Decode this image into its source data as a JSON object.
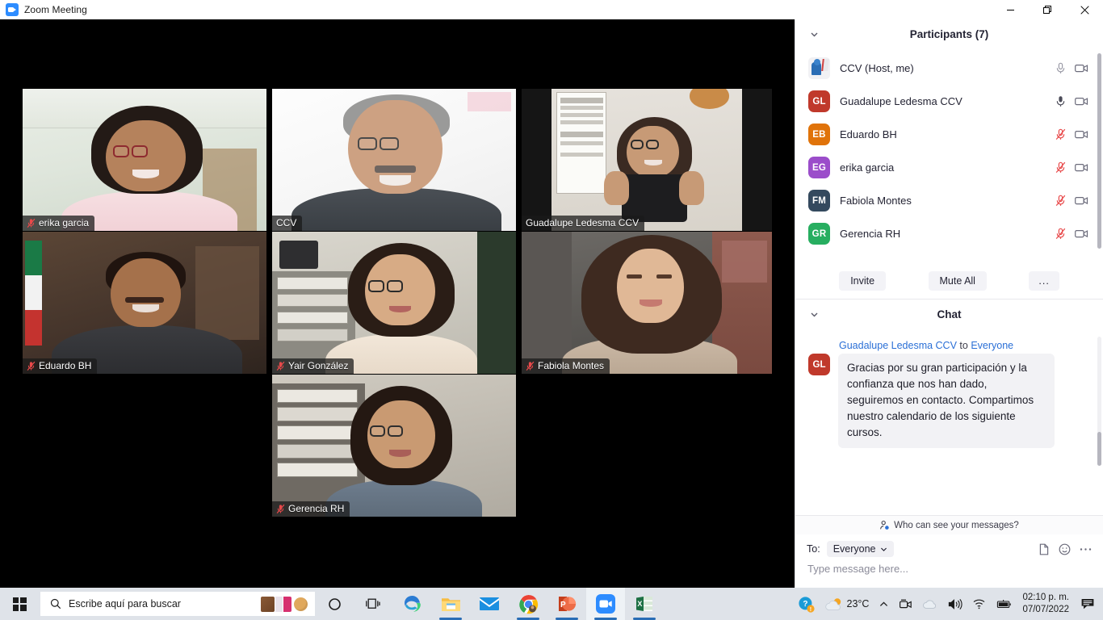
{
  "window": {
    "title": "Zoom Meeting",
    "app_icon": "zoom-video-icon",
    "minimize_label": "Minimize",
    "restore_label": "Restore",
    "close_label": "Close"
  },
  "gallery": {
    "tiles": [
      {
        "name": "erika garcia",
        "muted": true,
        "active_speaker": false
      },
      {
        "name": "CCV",
        "muted": false,
        "active_speaker": false
      },
      {
        "name": "Guadalupe Ledesma CCV",
        "muted": false,
        "active_speaker": true
      },
      {
        "name": "Eduardo BH",
        "muted": true,
        "active_speaker": false
      },
      {
        "name": "Yair González",
        "muted": true,
        "active_speaker": false
      },
      {
        "name": "Fabiola Montes",
        "muted": true,
        "active_speaker": false
      },
      {
        "name": "Gerencia RH",
        "muted": true,
        "active_speaker": false
      }
    ],
    "active_speaker_border_color": "#f5f56b"
  },
  "participants": {
    "header": "Participants (7)",
    "collapse_icon": "chevron-down-icon",
    "rows": [
      {
        "initials": "",
        "name": "CCV (Host, me)",
        "avatar_color": "#f1f1f4",
        "is_photo": true,
        "mic": "unmuted-light",
        "video": "on"
      },
      {
        "initials": "GL",
        "name": "Guadalupe Ledesma CCV",
        "avatar_color": "#c0392b",
        "is_photo": false,
        "mic": "unmuted-active",
        "video": "on"
      },
      {
        "initials": "EB",
        "name": "Eduardo BH",
        "avatar_color": "#e0730a",
        "is_photo": false,
        "mic": "muted",
        "video": "on"
      },
      {
        "initials": "EG",
        "name": "erika garcia",
        "avatar_color": "#9b4dca",
        "is_photo": false,
        "mic": "muted",
        "video": "on"
      },
      {
        "initials": "FM",
        "name": "Fabiola Montes",
        "avatar_color": "#34495e",
        "is_photo": false,
        "mic": "muted",
        "video": "on"
      },
      {
        "initials": "GR",
        "name": "Gerencia RH",
        "avatar_color": "#27ae60",
        "is_photo": false,
        "mic": "muted",
        "video": "on"
      }
    ],
    "buttons": {
      "invite": "Invite",
      "mute_all": "Mute All",
      "more": "..."
    }
  },
  "chat": {
    "header": "Chat",
    "collapse_icon": "chevron-down-icon",
    "message": {
      "sender": "Guadalupe Ledesma CCV",
      "to_word": " to ",
      "recipient": "Everyone",
      "avatar_initials": "GL",
      "avatar_color": "#c0392b",
      "text": "Gracias por su gran participación y la confianza que nos han dado, seguiremos en contacto. Compartimos nuestro calendario de los siguiente cursos."
    },
    "privacy_note": "Who can see your messages?",
    "privacy_icon": "person-info-icon",
    "to_label": "To:",
    "to_value": "Everyone",
    "to_chevron": "chevron-down-icon",
    "input_placeholder": "Type message here...",
    "input_value": "",
    "footer_icons": [
      "file-icon",
      "emoji-icon",
      "more-options-icon"
    ]
  },
  "taskbar": {
    "start_label": "Start",
    "search_placeholder": "Escribe aquí para buscar",
    "search_icon": "search-icon",
    "search_value": "",
    "cortana_label": "Cortana",
    "taskview_label": "Task View",
    "apps": [
      {
        "name": "microsoft-edge",
        "label": "Microsoft Edge",
        "open": false
      },
      {
        "name": "file-explorer",
        "label": "File Explorer",
        "open": true
      },
      {
        "name": "mail",
        "label": "Mail",
        "open": false
      },
      {
        "name": "google-chrome",
        "label": "Google Chrome",
        "open": true
      },
      {
        "name": "powerpoint",
        "label": "PowerPoint",
        "open": true
      },
      {
        "name": "zoom",
        "label": "Zoom",
        "open": true,
        "active": true
      },
      {
        "name": "excel",
        "label": "Excel",
        "open": true
      }
    ],
    "tray": {
      "help_icon": "help-badge-icon",
      "weather_icon": "partly-cloudy-icon",
      "temperature": "23°C",
      "show_hidden_icon": "chevron-up-icon",
      "meet_now_icon": "meet-now-icon",
      "onedrive_icon": "onedrive-icon",
      "volume_icon": "speaker-icon",
      "network_icon": "wifi-icon",
      "battery_icon": "battery-icon",
      "time": "02:10 p. m.",
      "date": "07/07/2022",
      "notifications_icon": "notifications-icon"
    }
  }
}
